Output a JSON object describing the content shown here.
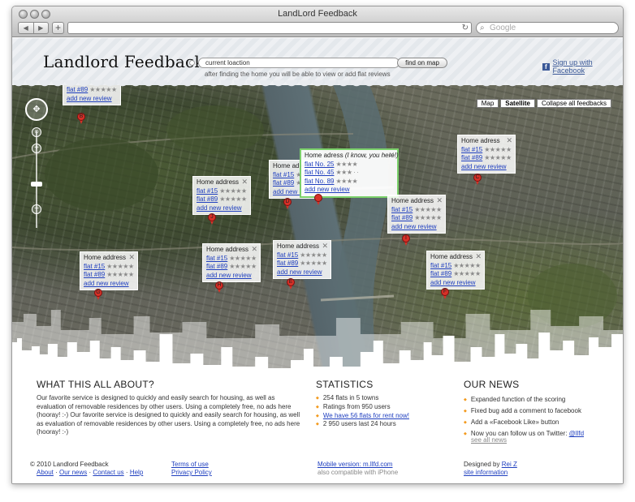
{
  "window": {
    "title": "LandLord Feedback"
  },
  "browser": {
    "search_placeholder": "Google",
    "nav_back": "◀",
    "nav_forward": "▶",
    "new_tab": "+",
    "reload": "↻"
  },
  "header": {
    "logo": "Landlord Feedback",
    "location_value": "current loaction",
    "find_button": "find on map",
    "hint": "after finding the home you will be able to view or add flat reviews",
    "facebook_link": "Sign up with Facebook"
  },
  "map": {
    "map_types": [
      "Map",
      "Satellite",
      "Collapse all feedbacks"
    ],
    "active_type": "Satellite",
    "popups": [
      {
        "title": "",
        "rows": [
          "flat #89"
        ],
        "add": "add new review",
        "stars": [
          3
        ],
        "partial": true
      },
      {
        "title": "Home address",
        "rows": [
          "flat #15",
          "flat #89"
        ],
        "add": "add new review",
        "stars": [
          4,
          3
        ]
      },
      {
        "title": "Home adress",
        "title_extra": "(I know, you here!)",
        "rows": [
          "flat No. 25",
          "flat No. 45",
          "flat No. 89"
        ],
        "add": "add new review",
        "stars": [
          4,
          3,
          2
        ]
      }
    ],
    "flat_15": "flat #15",
    "flat_89": "flat #89",
    "home_address": "Home address",
    "home_adress": "Home adress",
    "home_adress_trunc": "Home adres",
    "add_review": "add new review",
    "here_note": "(I know, you here!)",
    "flat_no_25": "flat No. 25",
    "flat_no_45": "flat No. 45",
    "flat_no_89": "flat No. 89",
    "close": "✕",
    "markers": [
      "B",
      "J",
      "D",
      "I",
      "C",
      "G",
      "H",
      "E",
      "F"
    ]
  },
  "about": {
    "title": "WHAT THIS ALL ABOUT?",
    "text": "Our favorite service is designed to quickly and easily search for housing, as well as evaluation of removable residences by other users. Using a completely free, no ads here (hooray! :-) Our favorite service is designed to quickly and easily search for housing, as well as evaluation of removable residences by other users. Using a completely free, no ads here (hooray! :-)"
  },
  "statistics": {
    "title": "STATISTICS",
    "items": [
      "254 flats in 5 towns",
      "Ratings from 950 users",
      "We have 56 flats for rent now!",
      "2 950 users last 24 hours"
    ]
  },
  "news": {
    "title": "OUR NEWS",
    "items": [
      "Expanded function of the scoring",
      "Fixed bug add a comment to facebook",
      "Add a «Facebook Like» button",
      "Now you can follow us on Twitter:"
    ],
    "twitter_handle": "@llfd",
    "see_all": "see all news"
  },
  "footer": {
    "copyright": "© 2010 Landlord Feedback",
    "links": [
      "About",
      "Our news",
      "Contact us",
      "Help"
    ],
    "sep": "·",
    "terms": "Terms of use",
    "privacy": "Privacy Policy",
    "mobile": "Mobile version: m.llfd.com",
    "compat": "also compatible with iPhone",
    "designed_by": "Designed by",
    "designer": "Rei Z",
    "site_info": "site information"
  },
  "colors": {
    "accent_orange": "#f39a1d",
    "link_blue": "#1f3fbf",
    "facebook_blue": "#3b5998",
    "marker_red": "#d73027"
  }
}
